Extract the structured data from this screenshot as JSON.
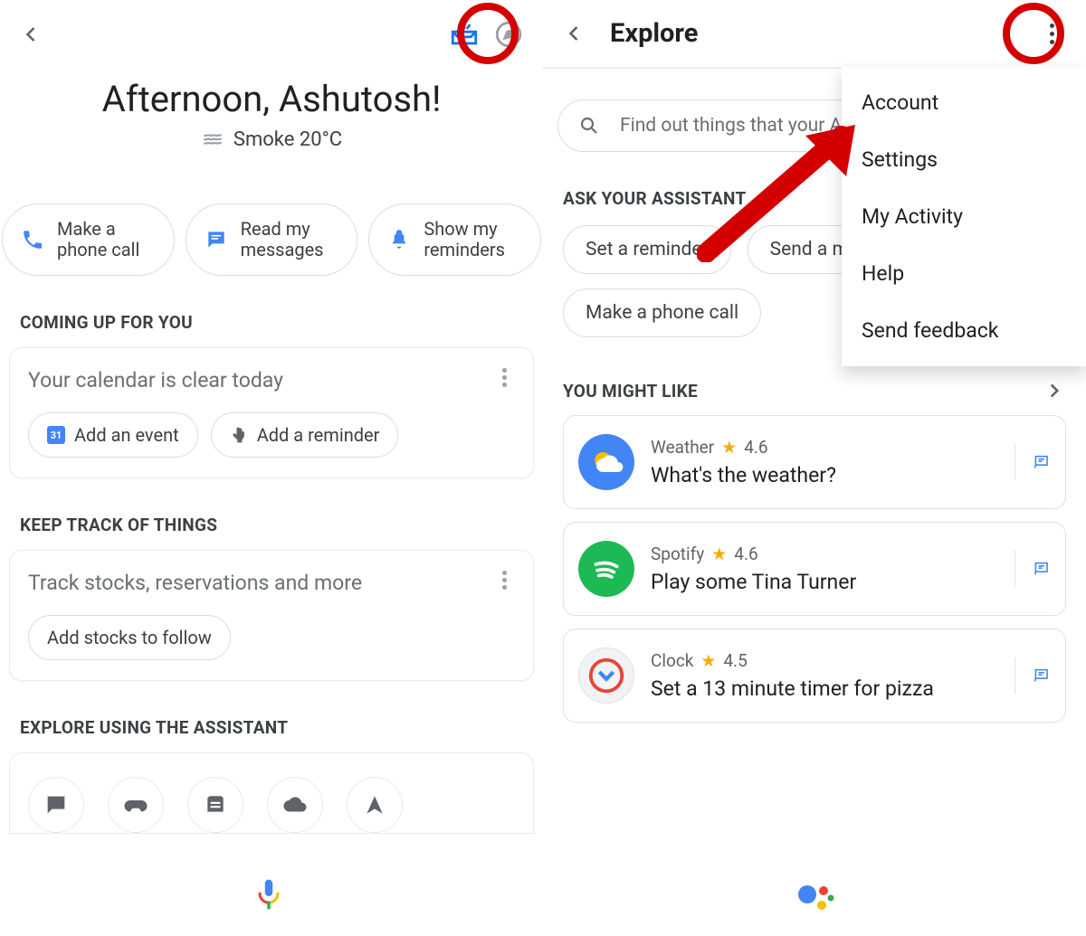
{
  "left": {
    "greeting": "Afternoon, Ashutosh!",
    "weather": "Smoke 20°C",
    "actions": [
      {
        "label": "Make a phone call"
      },
      {
        "label": "Read my messages"
      },
      {
        "label": "Show my reminders"
      }
    ],
    "section_coming": "COMING UP FOR YOU",
    "calendar_empty": "Your calendar is clear today",
    "add_event": "Add an event",
    "add_reminder": "Add a reminder",
    "section_track": "KEEP TRACK OF THINGS",
    "track_title": "Track stocks, reservations and more",
    "add_stocks": "Add stocks to follow",
    "section_explore": "EXPLORE USING THE ASSISTANT"
  },
  "right": {
    "title": "Explore",
    "search_placeholder": "Find out things that your Ass",
    "menu": {
      "account": "Account",
      "settings": "Settings",
      "activity": "My Activity",
      "help": "Help",
      "feedback": "Send feedback"
    },
    "section_ask": "ASK YOUR ASSISTANT",
    "chips": {
      "reminder": "Set a reminder",
      "message": "Send a messag",
      "call": "Make a phone call"
    },
    "section_like": "YOU MIGHT LIKE",
    "cards": [
      {
        "name": "Weather",
        "rating": "4.6",
        "cmd": "What's the weather?"
      },
      {
        "name": "Spotify",
        "rating": "4.6",
        "cmd": "Play some Tina Turner"
      },
      {
        "name": "Clock",
        "rating": "4.5",
        "cmd": "Set a 13 minute timer for pizza"
      }
    ]
  }
}
